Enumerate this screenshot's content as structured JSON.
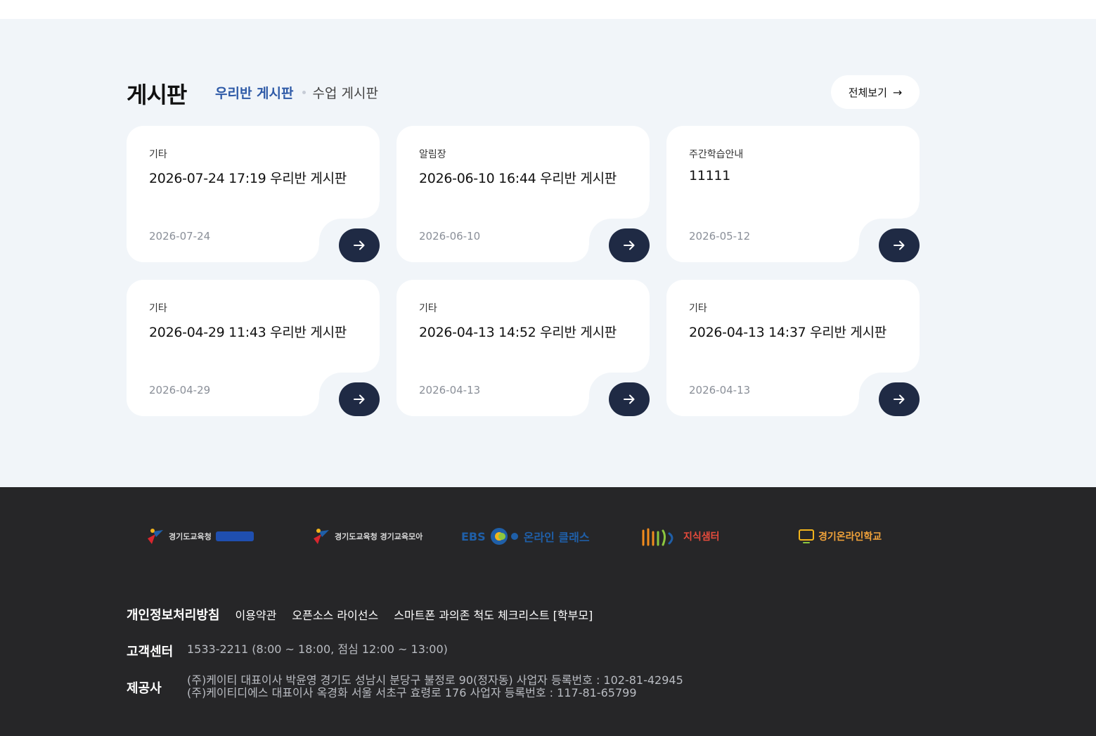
{
  "board": {
    "title": "게시판",
    "tab_active": "우리반 게시판",
    "tab_other": "수업 게시판",
    "view_all": "전체보기"
  },
  "cards": [
    {
      "category": "기타",
      "title": "2026-07-24 17:19 우리반 게시판",
      "date": "2026-07-24"
    },
    {
      "category": "알림장",
      "title": "2026-06-10 16:44 우리반 게시판",
      "date": "2026-06-10"
    },
    {
      "category": "주간학습안내",
      "title": "11111",
      "date": "2026-05-12"
    },
    {
      "category": "기타",
      "title": "2026-04-29 11:43 우리반 게시판",
      "date": "2026-04-29"
    },
    {
      "category": "기타",
      "title": "2026-04-13 14:52 우리반 게시판",
      "date": "2026-04-13"
    },
    {
      "category": "기타",
      "title": "2026-04-13 14:37 우리반 게시판",
      "date": "2026-04-13"
    }
  ],
  "footer": {
    "logos": {
      "gyeonggi_edu_1": "경기도교육청",
      "gyeonggi_edu_2": "경기도교육청 경기교육모아",
      "ebs_prefix": "EBS",
      "ebs_suffix": "온라인 클래스",
      "knowledge_center": "지식샘터",
      "online_school": "경기온라인학교"
    },
    "links": {
      "privacy": "개인정보처리방침",
      "terms": "이용약관",
      "opensource": "오픈소스 라이선스",
      "checklist": "스마트폰 과의존 척도 체크리스트 [학부모]"
    },
    "support_label": "고객센터",
    "support_text": "1533-2211 (8:00 ~ 18:00, 점심 12:00 ~ 13:00)",
    "provider_label": "제공사",
    "provider_line1": "(주)케이티 대표이사 박윤영 경기도 성남시 분당구 불정로 90(정자동) 사업자 등록번호 : 102-81-42945",
    "provider_line2": "(주)케이티디에스 대표이사 옥경화 서울 서초구 효령로 176 사업자 등록번호 : 117-81-65799"
  },
  "colors": {
    "accent": "#2e5aa7",
    "button_dark": "#1f2a44",
    "footer_bg": "#262628",
    "page_bg": "#f1f5f9"
  }
}
